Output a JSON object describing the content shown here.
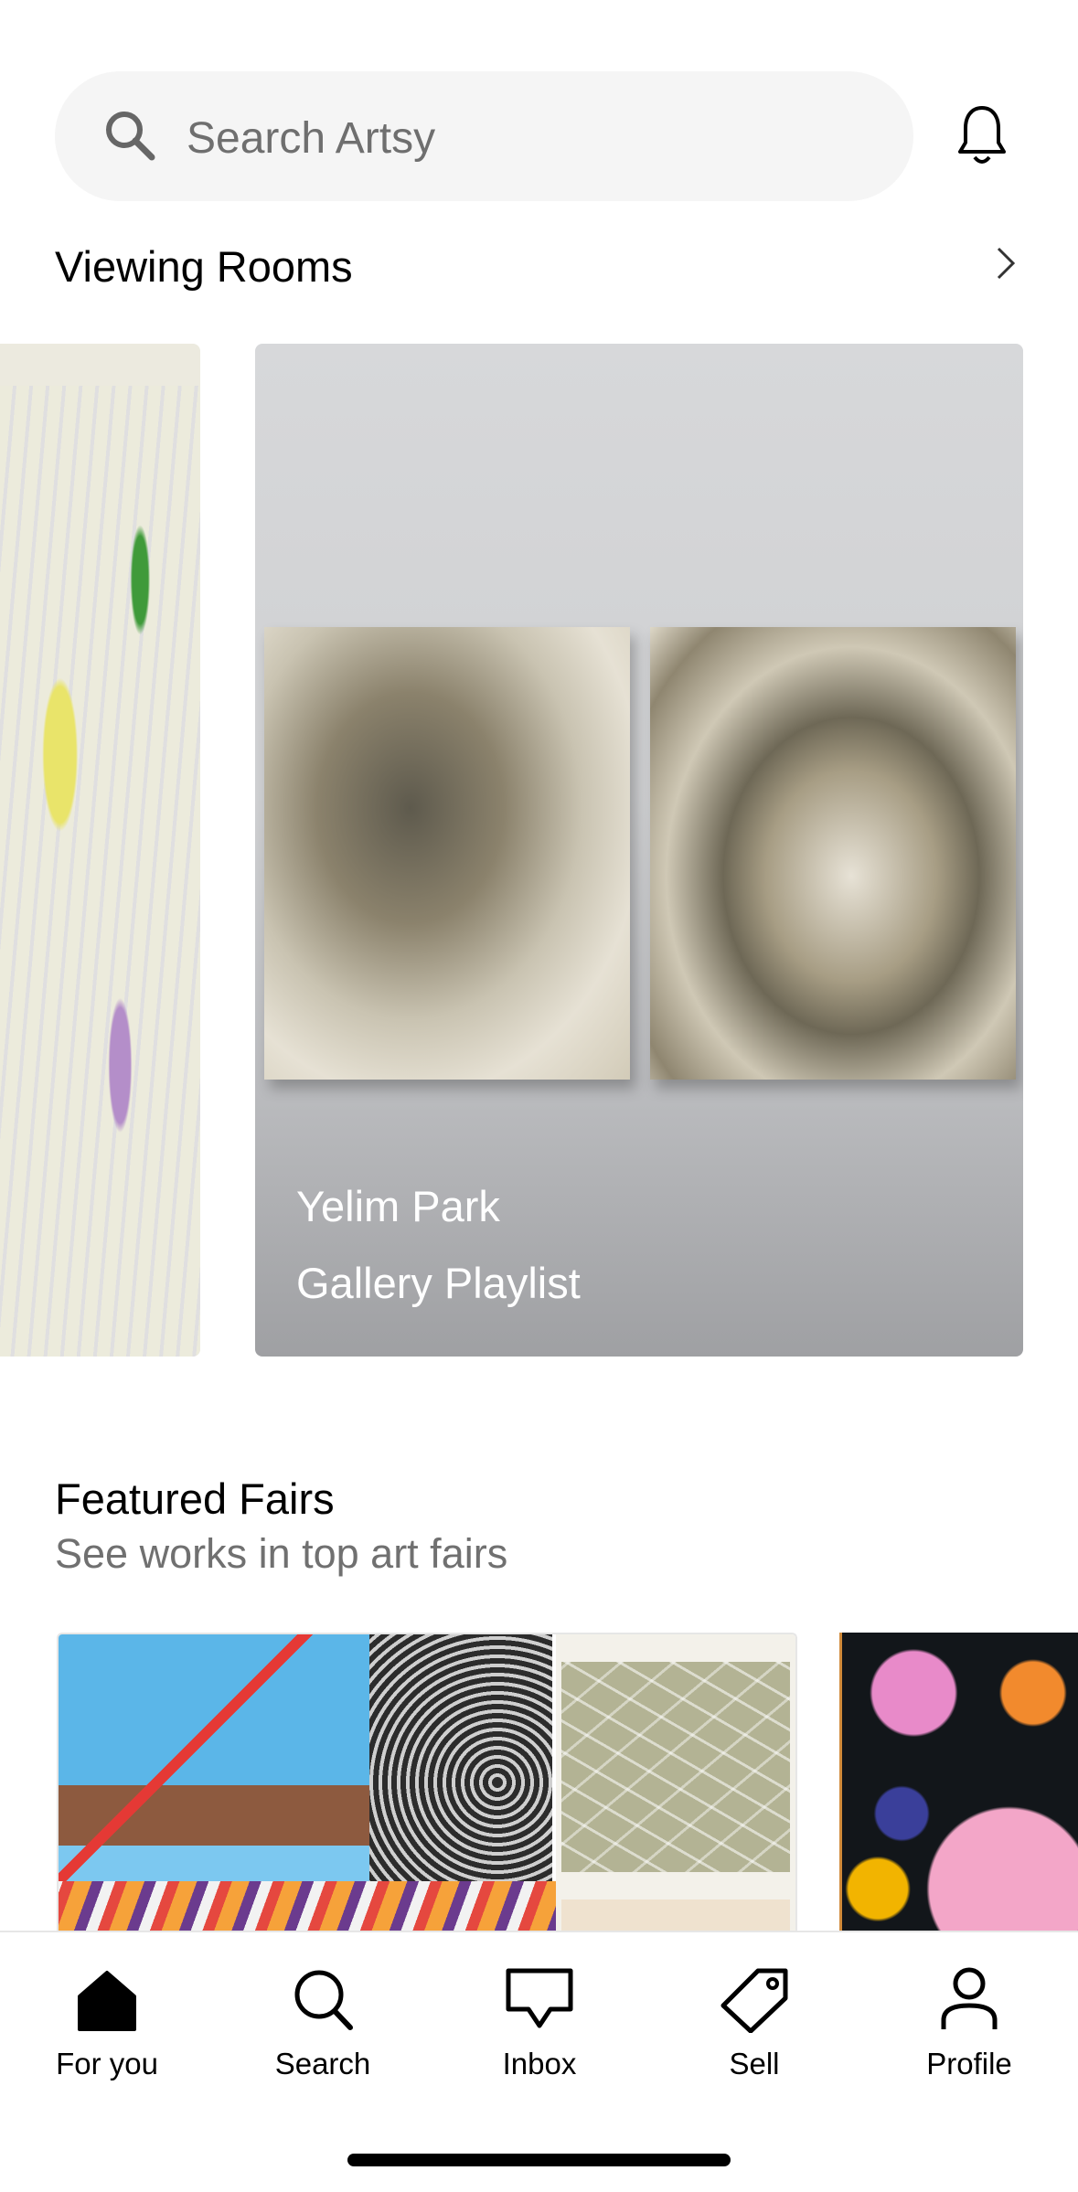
{
  "search": {
    "placeholder": "Search Artsy"
  },
  "viewing_rooms": {
    "title": "Viewing Rooms",
    "cards": [
      {
        "name": "Yelim Park",
        "subtitle": "Gallery Playlist"
      }
    ]
  },
  "featured_fairs": {
    "title": "Featured Fairs",
    "subtitle": "See works in top art fairs"
  },
  "tabs": [
    {
      "label": "For you",
      "icon": "home-icon"
    },
    {
      "label": "Search",
      "icon": "search-icon"
    },
    {
      "label": "Inbox",
      "icon": "inbox-icon"
    },
    {
      "label": "Sell",
      "icon": "tag-icon"
    },
    {
      "label": "Profile",
      "icon": "profile-icon"
    }
  ],
  "colors": {
    "text": "#000000",
    "secondary": "#707070",
    "search_bg": "#f5f5f5"
  }
}
